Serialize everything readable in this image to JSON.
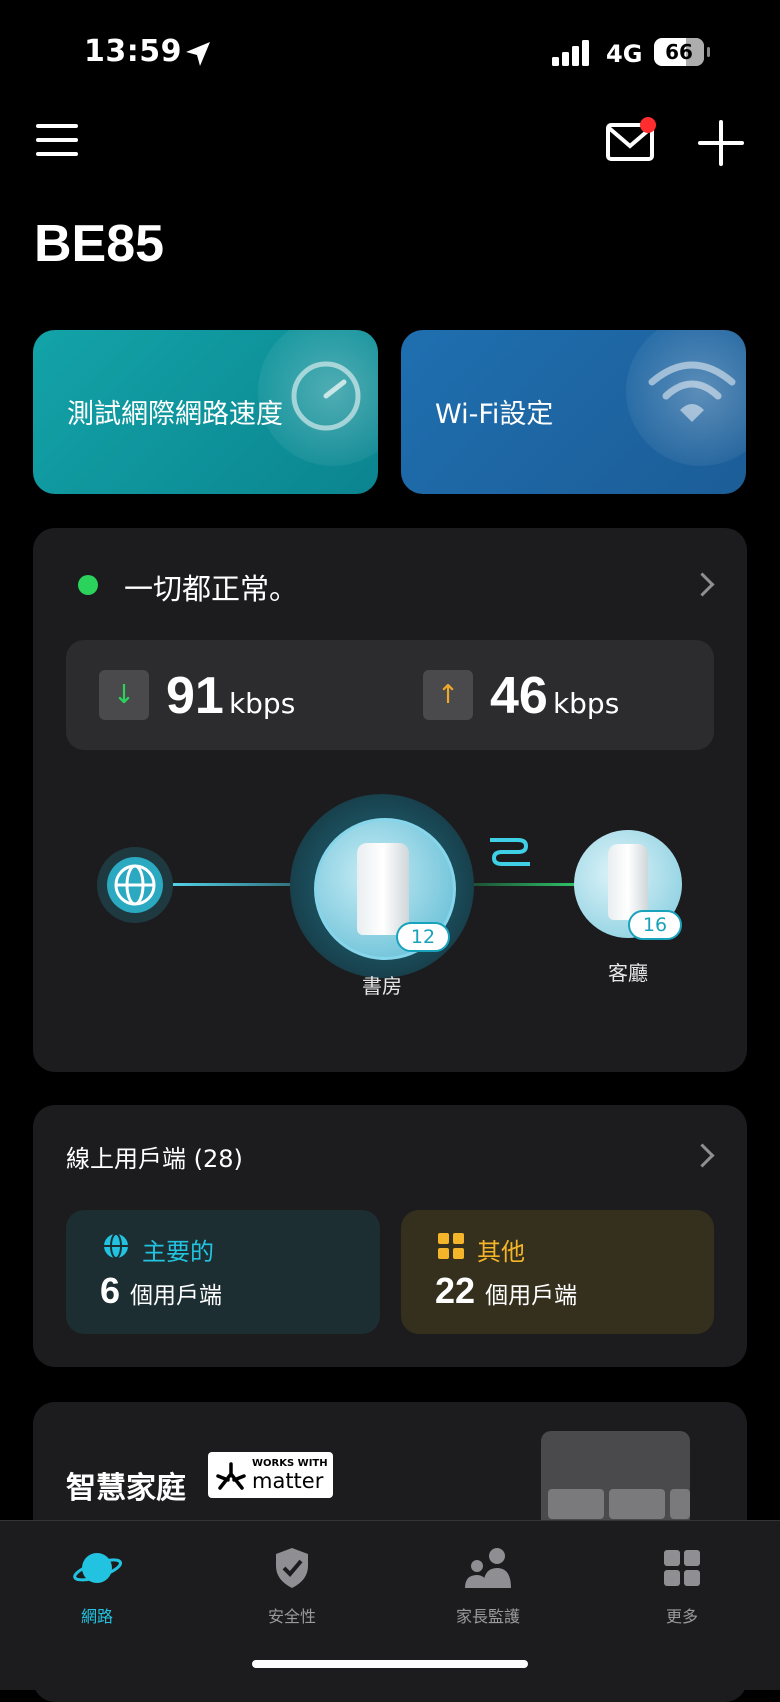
{
  "status_bar": {
    "time": "13:59",
    "network": "4G",
    "battery": "66"
  },
  "header": {
    "title": "BE85"
  },
  "quick_actions": {
    "speed_test": "測試網際網路速度",
    "wifi_settings": "Wi-Fi設定"
  },
  "status": {
    "message": "一切都正常。",
    "download_value": "91",
    "download_unit": "kbps",
    "upload_value": "46",
    "upload_unit": "kbps",
    "download_arrow": "↓",
    "upload_arrow": "↑"
  },
  "topology": {
    "main_node": {
      "name": "書房",
      "clients": "12"
    },
    "satellite_node": {
      "name": "客廳",
      "clients": "16"
    }
  },
  "clients": {
    "title": "線上用戶端 (28)",
    "main": {
      "label": "主要的",
      "count": "6",
      "unit": "個用戶端"
    },
    "other": {
      "label": "其他",
      "count": "22",
      "unit": "個用戶端"
    }
  },
  "smart_home": {
    "title": "智慧家庭",
    "badge_small": "WORKS WITH",
    "badge_main": "matter"
  },
  "tabs": [
    {
      "label": "網路",
      "icon": "planet-icon"
    },
    {
      "label": "安全性",
      "icon": "shield-check-icon"
    },
    {
      "label": "家長監護",
      "icon": "parents-icon"
    },
    {
      "label": "更多",
      "icon": "grid-icon"
    }
  ],
  "colors": {
    "accent": "#22c3e0",
    "ok": "#2bd35c",
    "download": "#2bd35c",
    "upload": "#f0a92a",
    "notification": "#ff2d2d"
  }
}
